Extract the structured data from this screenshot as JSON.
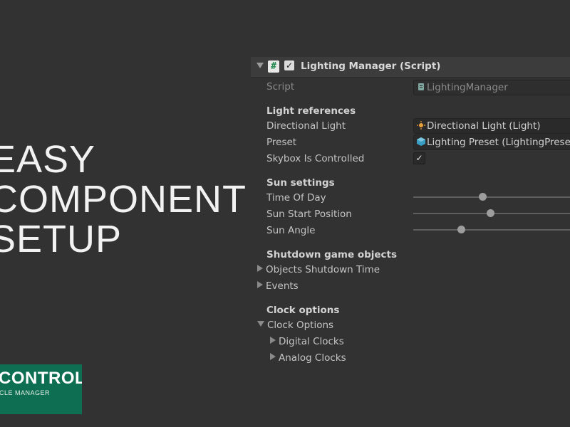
{
  "headline": [
    "EASY",
    "COMPONENT",
    "SETUP"
  ],
  "logo": {
    "title": "CONTROL",
    "subtitle": "CLE MANAGER"
  },
  "inspector": {
    "component_title": "Lighting Manager (Script)",
    "script_label": "Script",
    "script_value": "LightingManager",
    "light_references": {
      "heading": "Light references",
      "directional_light_label": "Directional Light",
      "directional_light_value": "Directional Light (Light)",
      "preset_label": "Preset",
      "preset_value": "Lighting Preset (LightingPreset)",
      "skybox_label": "Skybox Is Controlled",
      "skybox_checked": true
    },
    "sun_settings": {
      "heading": "Sun settings",
      "sliders": [
        {
          "label": "Time Of Day",
          "fraction": 0.42
        },
        {
          "label": "Sun Start Position",
          "fraction": 0.47
        },
        {
          "label": "Sun Angle",
          "fraction": 0.29
        }
      ]
    },
    "shutdown": {
      "heading": "Shutdown game objects",
      "objects_shutdown_time": "Objects Shutdown Time",
      "events": "Events"
    },
    "clock": {
      "heading": "Clock options",
      "clock_options": "Clock Options",
      "digital_clocks": "Digital Clocks",
      "analog_clocks": "Analog Clocks"
    }
  },
  "colors": {
    "background": "#323232",
    "logo_green": "#0e6e52"
  },
  "icons": [
    "fold-down-icon",
    "csharp-script-icon",
    "checkbox-icon",
    "light-icon",
    "preset-icon",
    "script-file-icon",
    "fold-right-icon"
  ]
}
